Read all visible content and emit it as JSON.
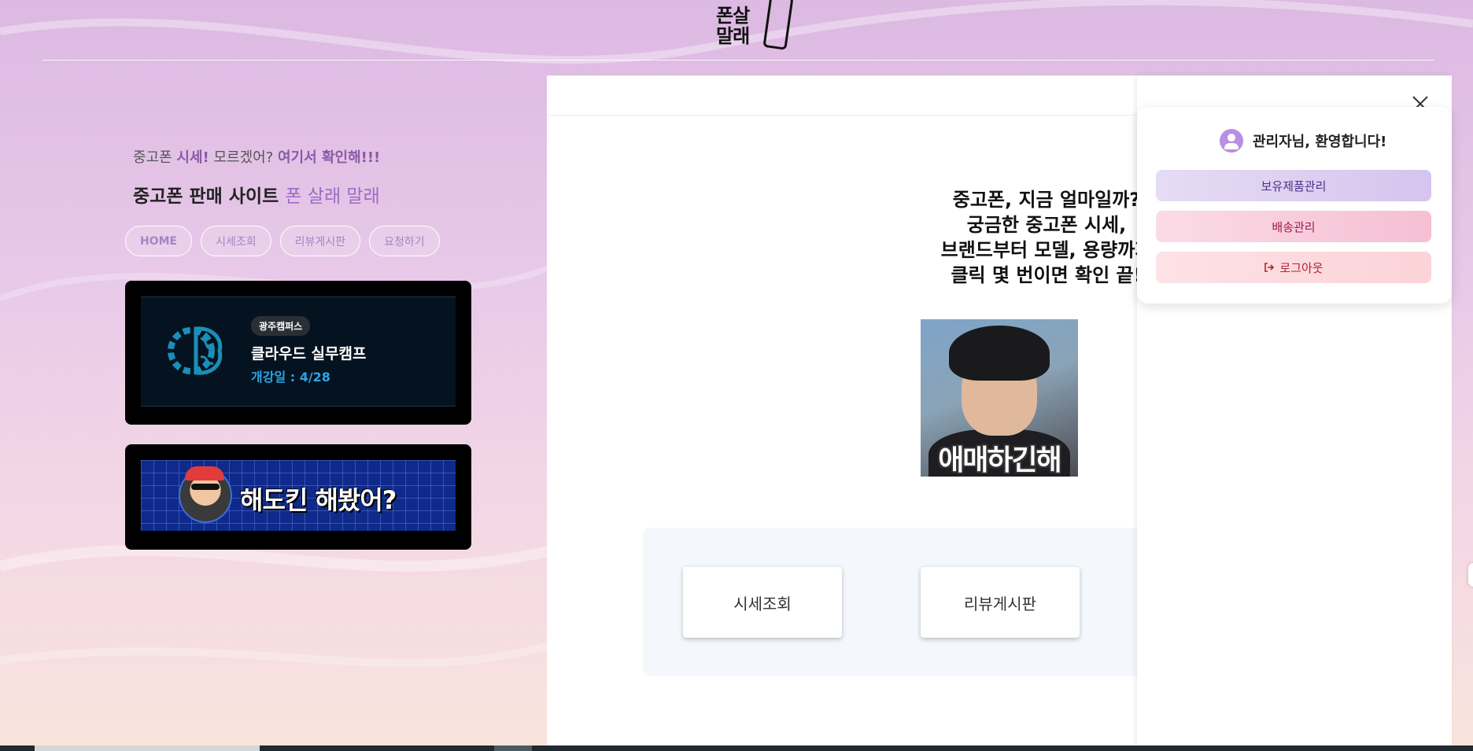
{
  "header": {
    "logo_line1": "폰살",
    "logo_line2": "말래"
  },
  "left": {
    "tagline_parts": [
      "중고폰 ",
      "시세!",
      " 모르겠어? ",
      "여기서 확인해!!!"
    ],
    "title_main": "중고폰 판매 사이트 ",
    "title_highlight": "폰 살래 말래",
    "nav": [
      "HOME",
      "시세조회",
      "리뷰게시판",
      "요청하기"
    ],
    "banner1": {
      "badge": "광주캠퍼스",
      "title": "클라우드 실무캠프",
      "date": "개강일 : 4/28"
    },
    "banner2": {
      "text": "해도킨 해봤어?"
    }
  },
  "main": {
    "hero_lines": [
      "중고폰, 지금 얼마일까?",
      "궁금한 중고폰 시세,",
      "브랜드부터 모델, 용량까지",
      "클릭 몇 번이면 확인 끝!"
    ],
    "meme_caption": "애매하긴해",
    "quick_links": [
      "시세조회",
      "리뷰게시판"
    ]
  },
  "panel": {
    "welcome": "관리자님, 환영합니다!",
    "buttons": [
      "보유제품관리",
      "배송관리",
      "로그아웃"
    ]
  },
  "colors": {
    "accent_purple": "#9b6bc4",
    "hero_text": "#111111",
    "panel_purple": "#4a2f8c",
    "panel_pink": "#a01a4e",
    "logout_red": "#b3222e"
  }
}
